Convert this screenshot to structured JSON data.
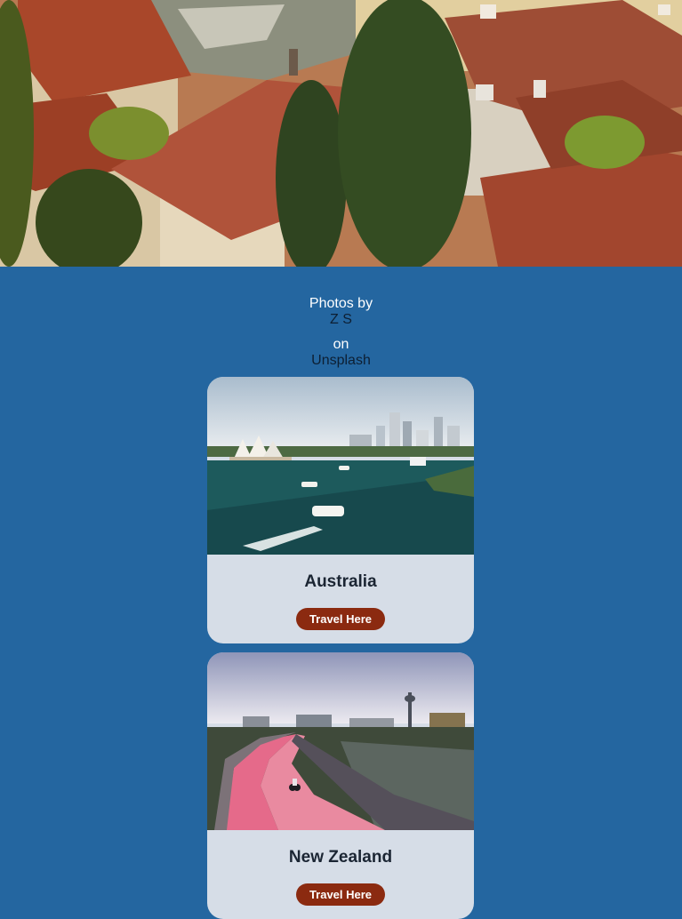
{
  "credit": {
    "prefix": "Photos by",
    "author": "Z S",
    "middle": "on",
    "site": "Unsplash"
  },
  "cards": [
    {
      "title": "Australia",
      "button_label": "Travel Here"
    },
    {
      "title": "New Zealand",
      "button_label": "Travel Here"
    }
  ],
  "colors": {
    "background": "#2466a0",
    "card": "#d6dde7",
    "button": "#8b2a10",
    "link": "#0d1f33"
  }
}
